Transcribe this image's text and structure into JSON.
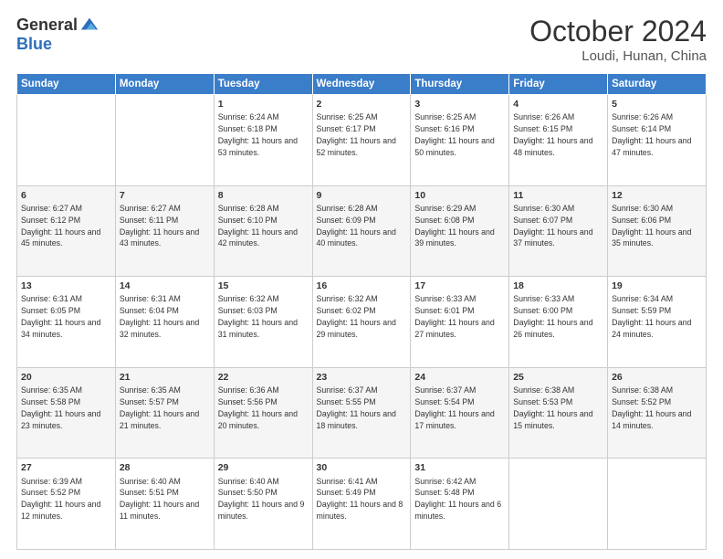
{
  "logo": {
    "general": "General",
    "blue": "Blue"
  },
  "title": "October 2024",
  "location": "Loudi, Hunan, China",
  "days_of_week": [
    "Sunday",
    "Monday",
    "Tuesday",
    "Wednesday",
    "Thursday",
    "Friday",
    "Saturday"
  ],
  "weeks": [
    [
      {
        "day": "",
        "info": ""
      },
      {
        "day": "",
        "info": ""
      },
      {
        "day": "1",
        "info": "Sunrise: 6:24 AM\nSunset: 6:18 PM\nDaylight: 11 hours and 53 minutes."
      },
      {
        "day": "2",
        "info": "Sunrise: 6:25 AM\nSunset: 6:17 PM\nDaylight: 11 hours and 52 minutes."
      },
      {
        "day": "3",
        "info": "Sunrise: 6:25 AM\nSunset: 6:16 PM\nDaylight: 11 hours and 50 minutes."
      },
      {
        "day": "4",
        "info": "Sunrise: 6:26 AM\nSunset: 6:15 PM\nDaylight: 11 hours and 48 minutes."
      },
      {
        "day": "5",
        "info": "Sunrise: 6:26 AM\nSunset: 6:14 PM\nDaylight: 11 hours and 47 minutes."
      }
    ],
    [
      {
        "day": "6",
        "info": "Sunrise: 6:27 AM\nSunset: 6:12 PM\nDaylight: 11 hours and 45 minutes."
      },
      {
        "day": "7",
        "info": "Sunrise: 6:27 AM\nSunset: 6:11 PM\nDaylight: 11 hours and 43 minutes."
      },
      {
        "day": "8",
        "info": "Sunrise: 6:28 AM\nSunset: 6:10 PM\nDaylight: 11 hours and 42 minutes."
      },
      {
        "day": "9",
        "info": "Sunrise: 6:28 AM\nSunset: 6:09 PM\nDaylight: 11 hours and 40 minutes."
      },
      {
        "day": "10",
        "info": "Sunrise: 6:29 AM\nSunset: 6:08 PM\nDaylight: 11 hours and 39 minutes."
      },
      {
        "day": "11",
        "info": "Sunrise: 6:30 AM\nSunset: 6:07 PM\nDaylight: 11 hours and 37 minutes."
      },
      {
        "day": "12",
        "info": "Sunrise: 6:30 AM\nSunset: 6:06 PM\nDaylight: 11 hours and 35 minutes."
      }
    ],
    [
      {
        "day": "13",
        "info": "Sunrise: 6:31 AM\nSunset: 6:05 PM\nDaylight: 11 hours and 34 minutes."
      },
      {
        "day": "14",
        "info": "Sunrise: 6:31 AM\nSunset: 6:04 PM\nDaylight: 11 hours and 32 minutes."
      },
      {
        "day": "15",
        "info": "Sunrise: 6:32 AM\nSunset: 6:03 PM\nDaylight: 11 hours and 31 minutes."
      },
      {
        "day": "16",
        "info": "Sunrise: 6:32 AM\nSunset: 6:02 PM\nDaylight: 11 hours and 29 minutes."
      },
      {
        "day": "17",
        "info": "Sunrise: 6:33 AM\nSunset: 6:01 PM\nDaylight: 11 hours and 27 minutes."
      },
      {
        "day": "18",
        "info": "Sunrise: 6:33 AM\nSunset: 6:00 PM\nDaylight: 11 hours and 26 minutes."
      },
      {
        "day": "19",
        "info": "Sunrise: 6:34 AM\nSunset: 5:59 PM\nDaylight: 11 hours and 24 minutes."
      }
    ],
    [
      {
        "day": "20",
        "info": "Sunrise: 6:35 AM\nSunset: 5:58 PM\nDaylight: 11 hours and 23 minutes."
      },
      {
        "day": "21",
        "info": "Sunrise: 6:35 AM\nSunset: 5:57 PM\nDaylight: 11 hours and 21 minutes."
      },
      {
        "day": "22",
        "info": "Sunrise: 6:36 AM\nSunset: 5:56 PM\nDaylight: 11 hours and 20 minutes."
      },
      {
        "day": "23",
        "info": "Sunrise: 6:37 AM\nSunset: 5:55 PM\nDaylight: 11 hours and 18 minutes."
      },
      {
        "day": "24",
        "info": "Sunrise: 6:37 AM\nSunset: 5:54 PM\nDaylight: 11 hours and 17 minutes."
      },
      {
        "day": "25",
        "info": "Sunrise: 6:38 AM\nSunset: 5:53 PM\nDaylight: 11 hours and 15 minutes."
      },
      {
        "day": "26",
        "info": "Sunrise: 6:38 AM\nSunset: 5:52 PM\nDaylight: 11 hours and 14 minutes."
      }
    ],
    [
      {
        "day": "27",
        "info": "Sunrise: 6:39 AM\nSunset: 5:52 PM\nDaylight: 11 hours and 12 minutes."
      },
      {
        "day": "28",
        "info": "Sunrise: 6:40 AM\nSunset: 5:51 PM\nDaylight: 11 hours and 11 minutes."
      },
      {
        "day": "29",
        "info": "Sunrise: 6:40 AM\nSunset: 5:50 PM\nDaylight: 11 hours and 9 minutes."
      },
      {
        "day": "30",
        "info": "Sunrise: 6:41 AM\nSunset: 5:49 PM\nDaylight: 11 hours and 8 minutes."
      },
      {
        "day": "31",
        "info": "Sunrise: 6:42 AM\nSunset: 5:48 PM\nDaylight: 11 hours and 6 minutes."
      },
      {
        "day": "",
        "info": ""
      },
      {
        "day": "",
        "info": ""
      }
    ]
  ]
}
